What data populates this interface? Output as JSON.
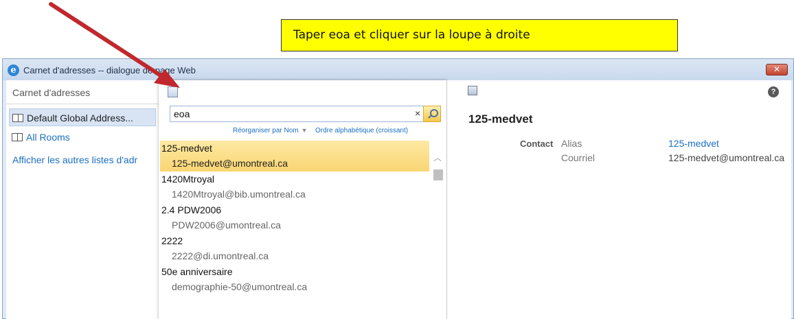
{
  "annotation": {
    "callout_text": "Taper eoa et cliquer sur la loupe à droite"
  },
  "window": {
    "title": "Carnet d'adresses -- dialogue de page Web",
    "close_label": "✕"
  },
  "left_pane": {
    "header": "Carnet d'adresses",
    "items": [
      {
        "label": "Default Global Address..."
      },
      {
        "label": "All Rooms"
      }
    ],
    "other_lists_link": "Afficher les autres listes d'adr"
  },
  "search": {
    "value": "eoa",
    "clear_label": "×",
    "sort_by": "Réorganiser par Nom",
    "sort_order": "Ordre alphabétique (croissant)"
  },
  "results": [
    {
      "name": "125-medvet",
      "email": "125-medvet@umontreal.ca"
    },
    {
      "name": "1420Mtroyal",
      "email": "1420Mtroyal@bib.umontreal.ca"
    },
    {
      "name": "2.4 PDW2006",
      "email": "PDW2006@umontreal.ca"
    },
    {
      "name": "2222",
      "email": "2222@di.umontreal.ca"
    },
    {
      "name": "50e anniversaire",
      "email": "demographie-50@umontreal.ca"
    }
  ],
  "scroll": {
    "up_glyph": "︿"
  },
  "details": {
    "help_glyph": "?",
    "name": "125-medvet",
    "section_label": "Contact",
    "alias_label": "Alias",
    "alias_value": "125-medvet",
    "email_label": "Courriel",
    "email_value": "125-medvet@umontreal.ca"
  },
  "colors": {
    "callout_bg": "#ffff00",
    "arrow": "#c0282d",
    "selection": "#f9d572",
    "link": "#1a6fc4"
  }
}
